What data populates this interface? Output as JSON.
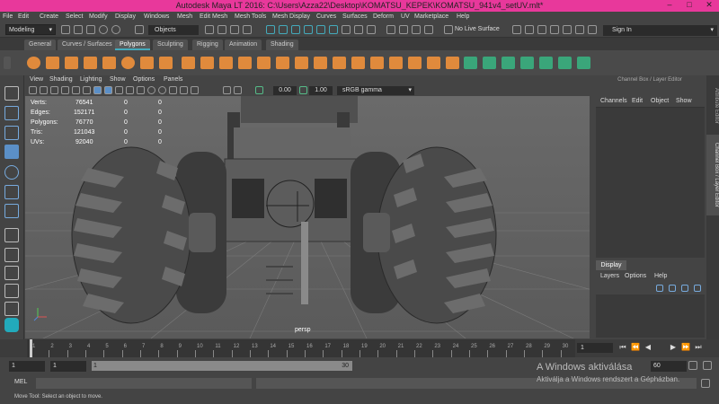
{
  "window": {
    "title": "Autodesk Maya LT 2016: C:\\Users\\Azza22\\Desktop\\KOMATSU_KEPEK\\KOMATSU_941v4_setUV.mlt*",
    "minimize": "–",
    "maximize": "□",
    "close": "✕"
  },
  "menu": [
    "File",
    "Edit",
    "Create",
    "Select",
    "Modify",
    "Display",
    "Windows",
    "Mesh",
    "Edit Mesh",
    "Mesh Tools",
    "Mesh Display",
    "Curves",
    "Surfaces",
    "Deform",
    "UV",
    "Marketplace",
    "Help"
  ],
  "status_line": {
    "mode": "Modeling",
    "mode_arrow": "▾",
    "objects": "Objects",
    "live_surface": "No Live Surface",
    "sign_in": "Sign In",
    "sign_in_arrow": "▾"
  },
  "shelf_tabs": [
    "General",
    "Curves / Surfaces",
    "Polygons",
    "Sculpting",
    "Rigging",
    "Animation",
    "Shading"
  ],
  "active_shelf_tab": "Polygons",
  "viewport": {
    "menu": [
      "View",
      "Shading",
      "Lighting",
      "Show",
      "Options",
      "Panels"
    ],
    "value_a": "0.00",
    "value_b": "1.00",
    "color_space": "sRGB gamma",
    "camera": "persp",
    "hud": [
      {
        "label": "Verts:",
        "v1": "76541",
        "v2": "0",
        "v3": "0"
      },
      {
        "label": "Edges:",
        "v1": "152171",
        "v2": "0",
        "v3": "0"
      },
      {
        "label": "Polygons:",
        "v1": "76770",
        "v2": "0",
        "v3": "0"
      },
      {
        "label": "Tris:",
        "v1": "121043",
        "v2": "0",
        "v3": "0"
      },
      {
        "label": "UVs:",
        "v1": "92040",
        "v2": "0",
        "v3": "0"
      }
    ]
  },
  "channel_box": {
    "title": "Channel Box / Layer Editor",
    "menu": [
      "Channels",
      "Edit",
      "Object",
      "Show"
    ],
    "display_tab": "Display",
    "layer_menu": [
      "Layers",
      "Options",
      "Help"
    ]
  },
  "side_tabs": [
    "Attribute Editor",
    "Channel Box / Layer Editor"
  ],
  "time_slider": {
    "ticks": [
      "1",
      "2",
      "3",
      "4",
      "5",
      "6",
      "7",
      "8",
      "9",
      "10",
      "11",
      "12",
      "13",
      "14",
      "15",
      "16",
      "17",
      "18",
      "19",
      "20",
      "21",
      "22",
      "23",
      "24",
      "25",
      "26",
      "27",
      "28",
      "29",
      "30"
    ],
    "current_frame": "1",
    "playback": [
      "⏮",
      "⏪",
      "◀",
      "▶",
      "⏩",
      "⏭"
    ]
  },
  "range_slider": {
    "start": "1",
    "anim_start": "1",
    "range_low": "1",
    "range_high": "30",
    "end": "60"
  },
  "command_line": {
    "label": "MEL"
  },
  "help_line": "Move Tool: Select an object to move.",
  "watermark": {
    "line1": "A Windows aktiválása",
    "line2": "Aktiválja a Windows rendszert a Gépházban."
  },
  "colors": {
    "title_bar": "#e8389b",
    "ui_bg": "#444444",
    "viewport_bg": "#646464",
    "shelf_icon": "#e08a3c",
    "shelf_icon_green": "#3aa67a"
  }
}
